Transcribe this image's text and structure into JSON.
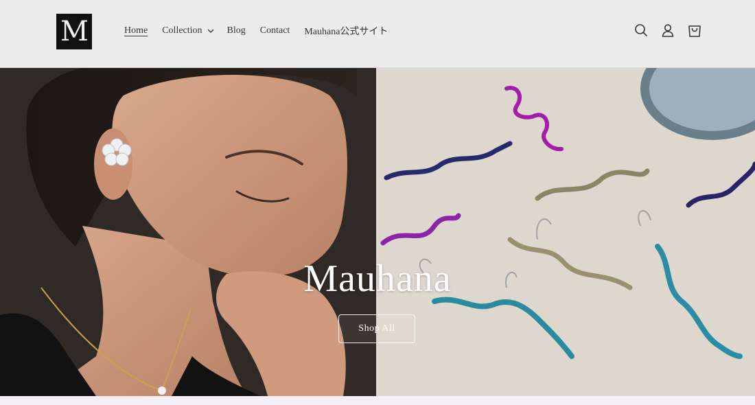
{
  "header": {
    "logo_letter": "M",
    "nav": {
      "home": "Home",
      "collection": "Collection",
      "blog": "Blog",
      "contact": "Contact",
      "official_site": "Mauhana公式サイト"
    },
    "icons": [
      "search-icon",
      "account-icon",
      "cart-icon"
    ]
  },
  "hero": {
    "title": "Mauhana",
    "button_label": "Shop All"
  },
  "colors": {
    "header_bg": "#ececec",
    "logo_bg": "#111111",
    "hero_text": "#ffffff"
  }
}
